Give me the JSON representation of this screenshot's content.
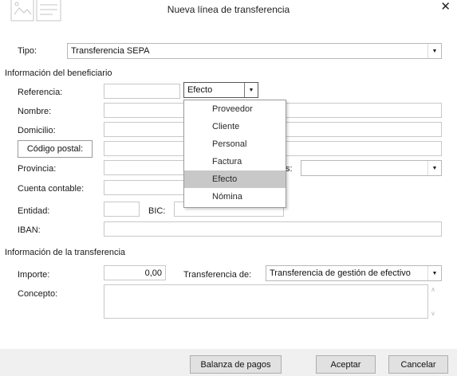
{
  "window": {
    "title": "Nueva línea de transferencia",
    "close_glyph": "✕"
  },
  "tipo": {
    "label": "Tipo:",
    "value": "Transferencia SEPA"
  },
  "beneficiario": {
    "section": "Información del beneficiario",
    "referencia_label": "Referencia:",
    "referencia_value": "",
    "referencia_type": "Efecto",
    "referencia_options": [
      "Proveedor",
      "Cliente",
      "Personal",
      "Factura",
      "Efecto",
      "Nómina"
    ],
    "nombre_label": "Nombre:",
    "domicilio_label": "Domicilio:",
    "codigo_postal_button": "Código postal:",
    "provincia_label": "Provincia:",
    "pais_label_fragment": "s:",
    "cuenta_label": "Cuenta contable:",
    "entidad_label": "Entidad:",
    "bic_label": "BIC:",
    "iban_label": "IBAN:"
  },
  "transferencia": {
    "section": "Información de la transferencia",
    "importe_label": "Importe:",
    "importe_value": "0,00",
    "transferencia_de_label": "Transferencia de:",
    "transferencia_de_value": "Transferencia de gestión de efectivo",
    "concepto_label": "Concepto:"
  },
  "footer": {
    "balanza_button": "Balanza de pagos",
    "aceptar_button": "Aceptar",
    "cancelar_button": "Cancelar"
  },
  "icons": {
    "dialog": "form-illustration-icon",
    "arrow": "chevron-down-icon"
  },
  "colors": {
    "selected_option": "#c8c8c8",
    "footer_bg": "#f0f0f0"
  }
}
